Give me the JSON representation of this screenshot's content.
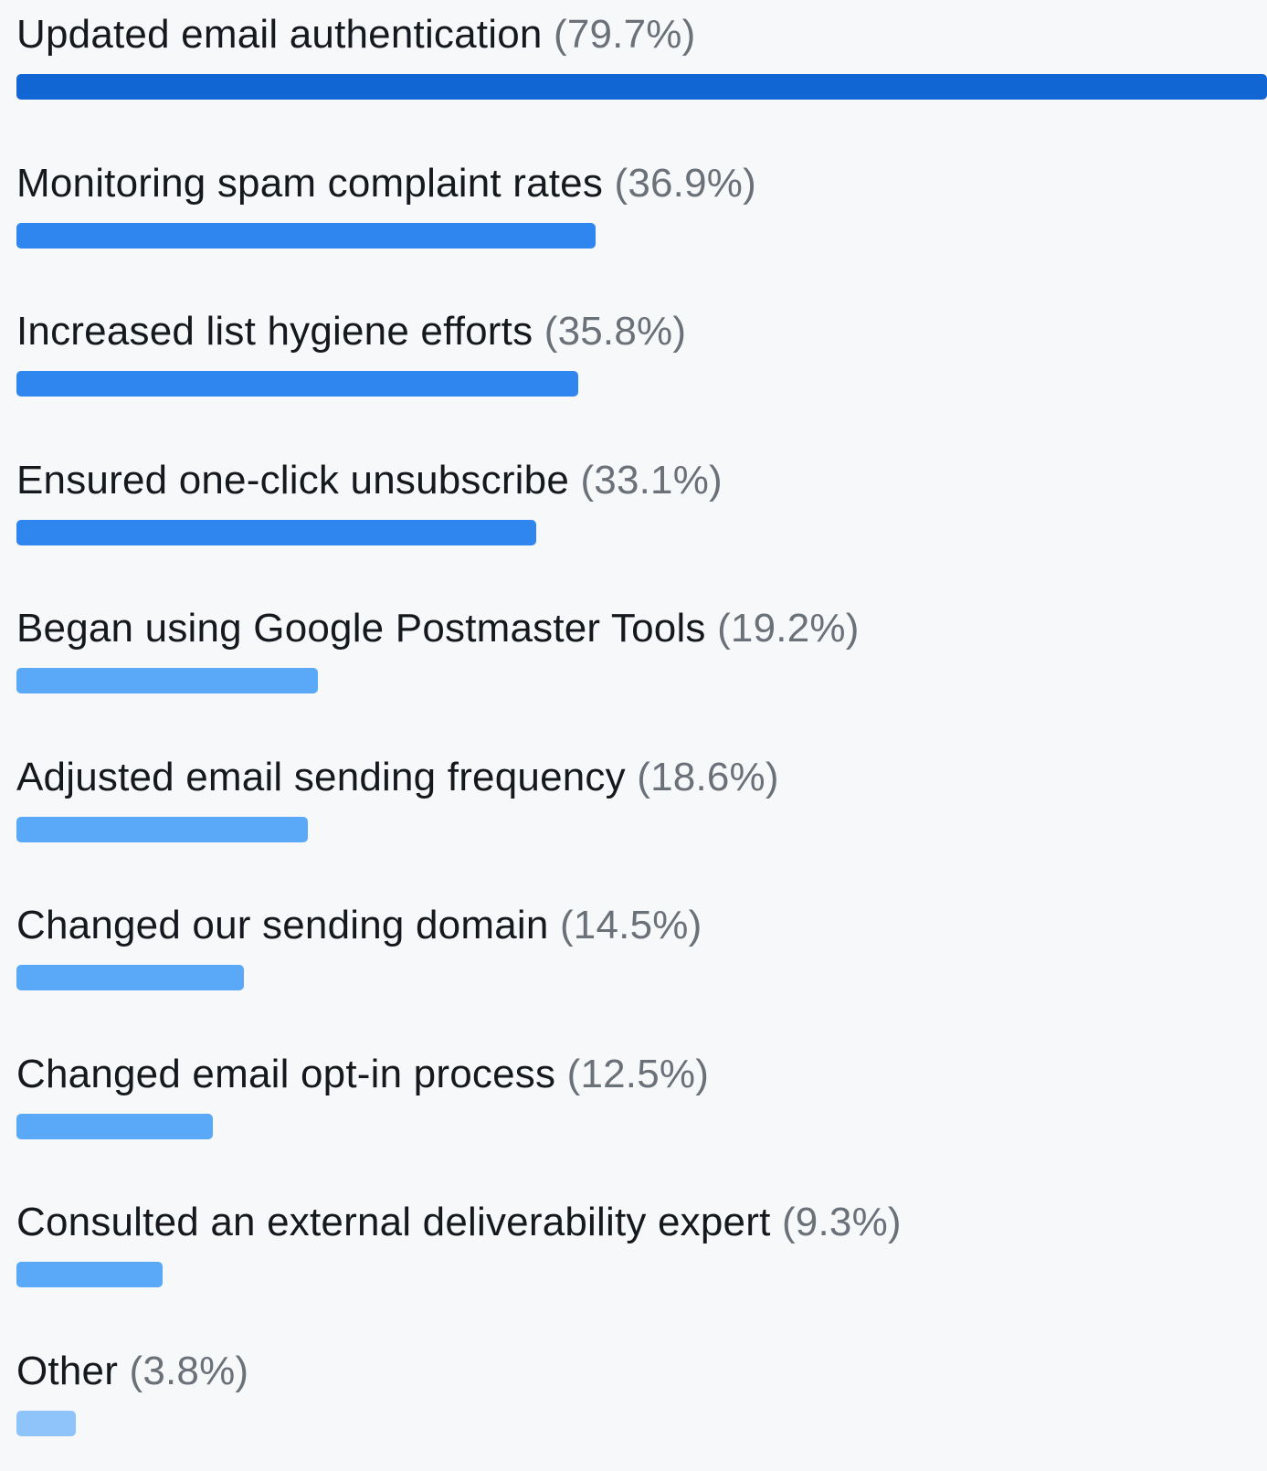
{
  "chart_data": {
    "type": "bar",
    "orientation": "horizontal",
    "categories": [
      "Updated email authentication",
      "Monitoring spam complaint rates",
      "Increased list hygiene efforts",
      "Ensured one-click unsubscribe",
      "Began using Google Postmaster Tools",
      "Adjusted email sending frequency",
      "Changed our sending domain",
      "Changed email opt-in process",
      "Consulted an external deliverability expert",
      "Other"
    ],
    "values": [
      79.7,
      36.9,
      35.8,
      33.1,
      19.2,
      18.6,
      14.5,
      12.5,
      9.3,
      3.8
    ],
    "value_labels": [
      "(79.7%)",
      "(36.9%)",
      "(35.8%)",
      "(33.1%)",
      "(19.2%)",
      "(18.6%)",
      "(14.5%)",
      "(12.5%)",
      "(9.3%)",
      "(3.8%)"
    ],
    "bar_colors": [
      "#1166d4",
      "#2f86ee",
      "#2f86ee",
      "#2f86ee",
      "#5aa8f8",
      "#5aa8f8",
      "#5aa8f8",
      "#5aa8f8",
      "#5aa8f8",
      "#8fc4fb"
    ],
    "xlim": [
      0,
      79.7
    ],
    "grid": false,
    "legend": "none"
  }
}
